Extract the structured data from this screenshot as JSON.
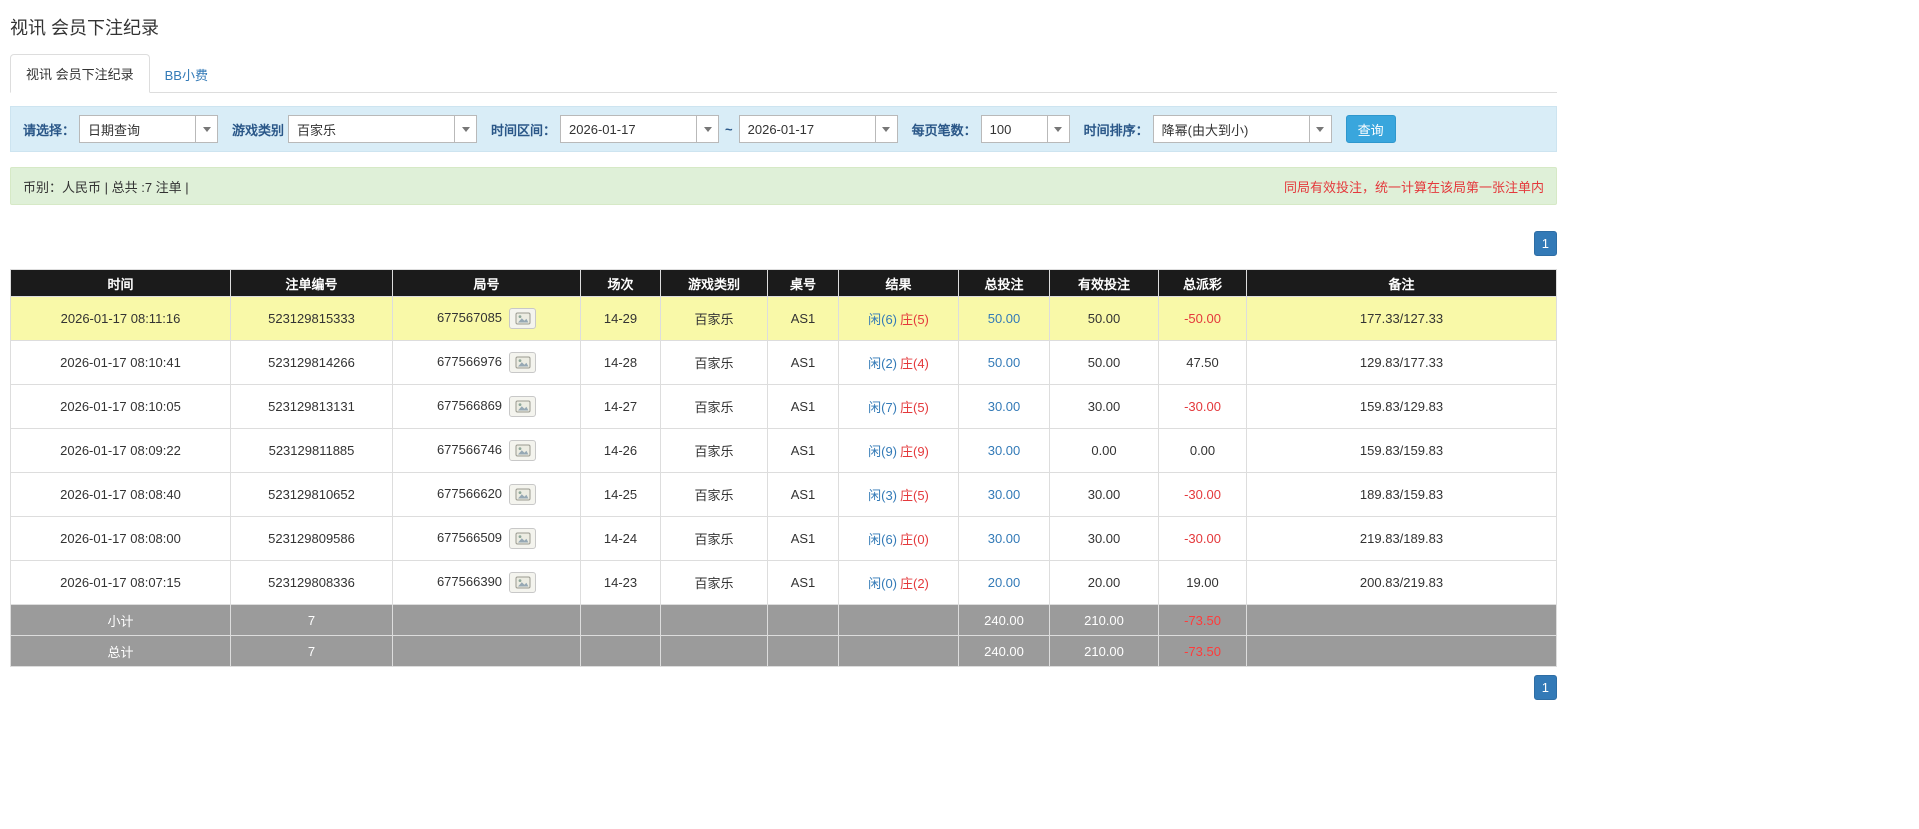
{
  "page": {
    "title": "视讯 会员下注纪录"
  },
  "tabs": {
    "records": "视讯 会员下注纪录",
    "bb_tip": "BB小费"
  },
  "filters": {
    "select_label": "请选择：",
    "select_value": "日期查询",
    "game_label": "游戏类别",
    "game_value": "百家乐",
    "range_label": "时间区间：",
    "date_from": "2026-01-17",
    "tilde": "~",
    "date_to": "2026-01-17",
    "pagesize_label": "每页笔数：",
    "pagesize_value": "100",
    "sort_label": "时间排序：",
    "sort_value": "降幂(由大到小)",
    "search_button": "查询"
  },
  "summary": {
    "left": "币别：人民币 | 总共 :7 注单 |",
    "right": "同局有效投注，统一计算在该局第一张注单内"
  },
  "pagination": {
    "page": "1"
  },
  "table": {
    "headers": [
      "时间",
      "注单编号",
      "局号",
      "场次",
      "游戏类别",
      "桌号",
      "结果",
      "总投注",
      "有效投注",
      "总派彩",
      "备注"
    ],
    "rows": [
      {
        "time": "2026-01-17 08:11:16",
        "order_no": "523129815333",
        "round_no": "677567085",
        "session": "14-29",
        "game": "百家乐",
        "table_no": "AS1",
        "player": "闲(6)",
        "banker": "庄(5)",
        "total_bet": "50.00",
        "valid_bet": "50.00",
        "payout": "-50.00",
        "note": "177.33/127.33",
        "highlight": true
      },
      {
        "time": "2026-01-17 08:10:41",
        "order_no": "523129814266",
        "round_no": "677566976",
        "session": "14-28",
        "game": "百家乐",
        "table_no": "AS1",
        "player": "闲(2)",
        "banker": "庄(4)",
        "total_bet": "50.00",
        "valid_bet": "50.00",
        "payout": "47.50",
        "note": "129.83/177.33",
        "highlight": false
      },
      {
        "time": "2026-01-17 08:10:05",
        "order_no": "523129813131",
        "round_no": "677566869",
        "session": "14-27",
        "game": "百家乐",
        "table_no": "AS1",
        "player": "闲(7)",
        "banker": "庄(5)",
        "total_bet": "30.00",
        "valid_bet": "30.00",
        "payout": "-30.00",
        "note": "159.83/129.83",
        "highlight": false
      },
      {
        "time": "2026-01-17 08:09:22",
        "order_no": "523129811885",
        "round_no": "677566746",
        "session": "14-26",
        "game": "百家乐",
        "table_no": "AS1",
        "player": "闲(9)",
        "banker": "庄(9)",
        "total_bet": "30.00",
        "valid_bet": "0.00",
        "payout": "0.00",
        "note": "159.83/159.83",
        "highlight": false
      },
      {
        "time": "2026-01-17 08:08:40",
        "order_no": "523129810652",
        "round_no": "677566620",
        "session": "14-25",
        "game": "百家乐",
        "table_no": "AS1",
        "player": "闲(3)",
        "banker": "庄(5)",
        "total_bet": "30.00",
        "valid_bet": "30.00",
        "payout": "-30.00",
        "note": "189.83/159.83",
        "highlight": false
      },
      {
        "time": "2026-01-17 08:08:00",
        "order_no": "523129809586",
        "round_no": "677566509",
        "session": "14-24",
        "game": "百家乐",
        "table_no": "AS1",
        "player": "闲(6)",
        "banker": "庄(0)",
        "total_bet": "30.00",
        "valid_bet": "30.00",
        "payout": "-30.00",
        "note": "219.83/189.83",
        "highlight": false
      },
      {
        "time": "2026-01-17 08:07:15",
        "order_no": "523129808336",
        "round_no": "677566390",
        "session": "14-23",
        "game": "百家乐",
        "table_no": "AS1",
        "player": "闲(0)",
        "banker": "庄(2)",
        "total_bet": "20.00",
        "valid_bet": "20.00",
        "payout": "19.00",
        "note": "200.83/219.83",
        "highlight": false
      }
    ],
    "subtotal": {
      "label": "小计",
      "count": "7",
      "total_bet": "240.00",
      "valid_bet": "210.00",
      "payout": "-73.50"
    },
    "total": {
      "label": "总计",
      "count": "7",
      "total_bet": "240.00",
      "valid_bet": "210.00",
      "payout": "-73.50"
    }
  }
}
